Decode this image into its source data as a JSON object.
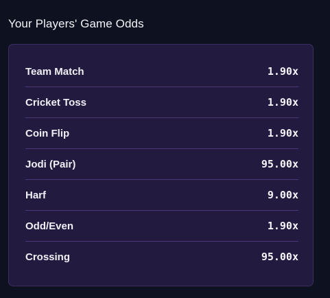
{
  "section_title": "Your Players' Game Odds",
  "games": [
    {
      "name": "Team Match",
      "odds": "1.90x"
    },
    {
      "name": "Cricket Toss",
      "odds": "1.90x"
    },
    {
      "name": "Coin Flip",
      "odds": "1.90x"
    },
    {
      "name": "Jodi (Pair)",
      "odds": "95.00x"
    },
    {
      "name": "Harf",
      "odds": "9.00x"
    },
    {
      "name": "Odd/Even",
      "odds": "1.90x"
    },
    {
      "name": "Crossing",
      "odds": "95.00x"
    }
  ],
  "colors": {
    "background": "#0d1120",
    "card": "#231a3f",
    "card_border": "#3c2d63",
    "divider": "#4c3777",
    "text": "#f1f1f8"
  }
}
